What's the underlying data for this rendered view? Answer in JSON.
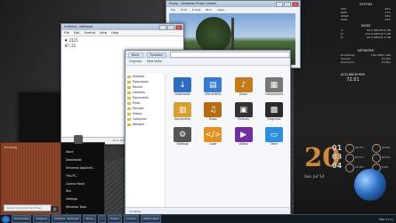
{
  "notepad": {
    "title": "Untitled - Notepad",
    "menu": [
      "File",
      "Edit",
      "Format",
      "View",
      "Help"
    ],
    "lines": [
      "♥ 2121",
      "07:21"
    ],
    "status": [
      "Ln 2, Col 7",
      "100%",
      "Windows (CRLF)",
      "UTF-8"
    ]
  },
  "photo_viewer": {
    "title": "Photo - Windows Photo Viewer",
    "menu": [
      "File",
      "Print",
      "E-mail",
      "Burn",
      "Open"
    ]
  },
  "explorer": {
    "nav_buttons": [
      "Back",
      "Forward"
    ],
    "toolbar": [
      "Organize",
      "New folder"
    ],
    "nav_items": [
      "Desktop",
      "Downloads",
      "Recent",
      "Libraries",
      "Documents",
      "Music",
      "Pictures",
      "Videos",
      "Computer",
      "Network"
    ],
    "tiles": [
      {
        "label": "Downloads",
        "color": "#2e6cc0",
        "glyph": "↓"
      },
      {
        "label": "Documents",
        "color": "#3a7ad0",
        "glyph": "▤"
      },
      {
        "label": "Music",
        "color": "#c27a1a",
        "glyph": "♪"
      },
      {
        "label": "Compressed",
        "color": "#777777",
        "glyph": "▦"
      },
      {
        "label": "Documents",
        "color": "#d6a030",
        "glyph": "▥"
      },
      {
        "label": "Music",
        "color": "#b86a10",
        "glyph": "♫"
      },
      {
        "label": "Pictures",
        "color": "#333333",
        "glyph": "▣"
      },
      {
        "label": "Programs",
        "color": "#2a2a2a",
        "glyph": "▩"
      },
      {
        "label": "Settings",
        "color": "#555555",
        "glyph": "⚙"
      },
      {
        "label": "Code",
        "color": "#e09020",
        "glyph": "</>"
      },
      {
        "label": "Videos",
        "color": "#7030a0",
        "glyph": "▶"
      },
      {
        "label": "Other",
        "color": "#2e8fe0",
        "glyph": "▭"
      }
    ],
    "status": "12 items"
  },
  "start_menu": {
    "user": "bluebug",
    "items": [
      "Store",
      "Downloads",
      "Universal Applicati...",
      "This PC",
      "Control Panel",
      "Run",
      "Settings",
      "Windows Tools",
      "Run"
    ],
    "search_placeholder": "Search programs and files"
  },
  "rainmeter": {
    "system": {
      "title": "SYSTEM",
      "rows": [
        [
          "CPU",
          "40%"
        ],
        [
          "RAM",
          "37%"
        ],
        [
          "SWAP",
          "39%"
        ],
        [
          "DISK",
          "23%"
        ]
      ]
    },
    "disks": {
      "title": "DISKS",
      "rows": [
        [
          "C:",
          "80.5 GB/120.0 GB"
        ],
        [
          "D:",
          "110.8 GB/232.0 GB"
        ],
        [
          "E:",
          "20.3 GB/931.0 GB"
        ]
      ]
    },
    "network": {
      "title": "NETWORK",
      "rows": [
        [
          "IP Address",
          "192.168.0.100"
        ],
        [
          "Upload",
          "0.0 B/s"
        ],
        [
          "Download",
          "0.0 B/s"
        ]
      ]
    },
    "weather": {
      "title": "ACCUWEATHER",
      "temp": "72.01"
    },
    "date": {
      "day": "20",
      "weekday": "Sun, Jul '14",
      "numbers": [
        "01",
        "03",
        "04"
      ]
    },
    "gauges": [
      "28.7%",
      "29.6%",
      "53.1%",
      "40.5%",
      "12.3%",
      "6.0%"
    ]
  },
  "taskbar": {
    "items": [
      "Downloads",
      "Desktop",
      "Untitled - Notepad",
      "Photo",
      "...",
      "Firefox",
      "Control",
      "What's New"
    ],
    "tray": "ENG 07:21"
  }
}
